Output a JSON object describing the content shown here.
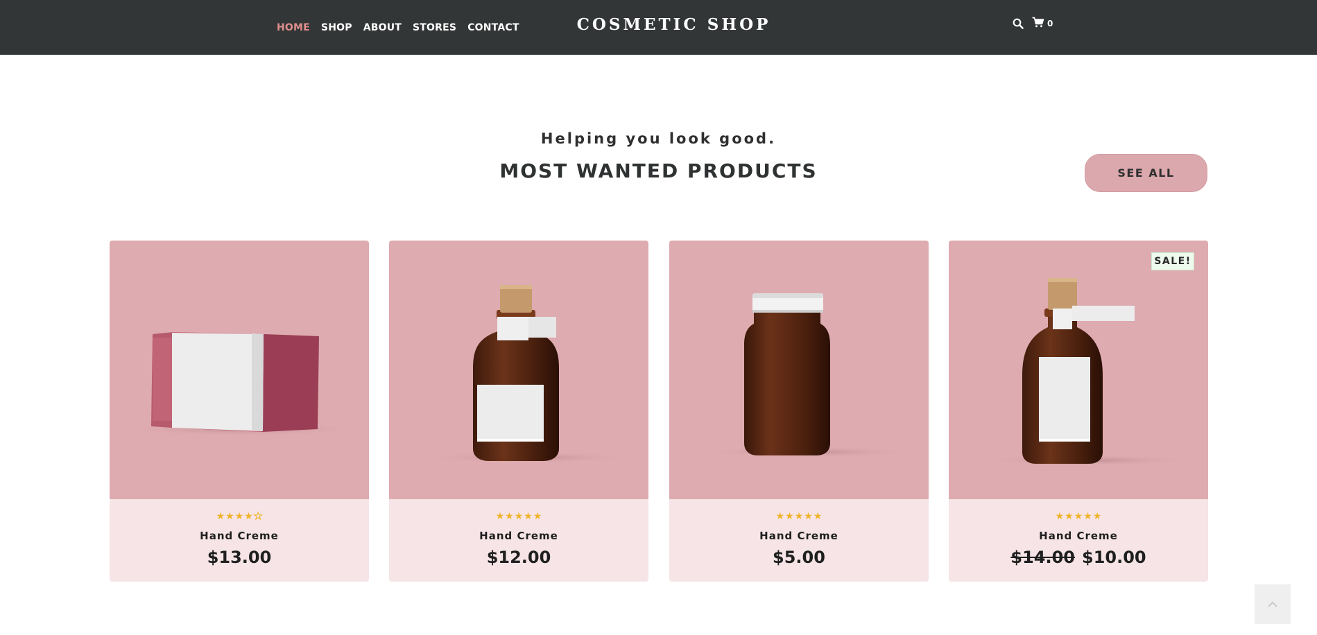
{
  "header": {
    "nav": [
      {
        "label": "HOME",
        "active": true
      },
      {
        "label": "SHOP",
        "active": false
      },
      {
        "label": "ABOUT",
        "active": false
      },
      {
        "label": "STORES",
        "active": false
      },
      {
        "label": "CONTACT",
        "active": false
      }
    ],
    "brand": "COSMETIC SHOP",
    "search_icon": "search-icon",
    "cart_icon": "cart-icon",
    "cart_count": "0"
  },
  "section": {
    "tagline": "Helping you look good.",
    "title": "MOST WANTED PRODUCTS",
    "see_all_label": "SEE ALL"
  },
  "products": [
    {
      "name": "Hand Creme",
      "price": "$13.00",
      "rating": 4,
      "image": "soap-bar"
    },
    {
      "name": "Hand Creme",
      "price": "$12.00",
      "rating": 5,
      "image": "cork-bottle"
    },
    {
      "name": "Hand Creme",
      "price": "$5.00",
      "rating": 5,
      "image": "jar"
    },
    {
      "name": "Hand Creme",
      "old_price": "$14.00",
      "price": "$10.00",
      "rating": 5,
      "image": "cork-bottle",
      "badge": "SALE!"
    }
  ],
  "colors": {
    "header_bg": "#323636",
    "nav_active": "#e08d8d",
    "card_image_bg": "#deabb0",
    "card_info_bg": "#f6e4e6",
    "button_bg": "#dba8ae",
    "star": "#f0b429"
  },
  "back_to_top_icon": "chevron-up-icon"
}
